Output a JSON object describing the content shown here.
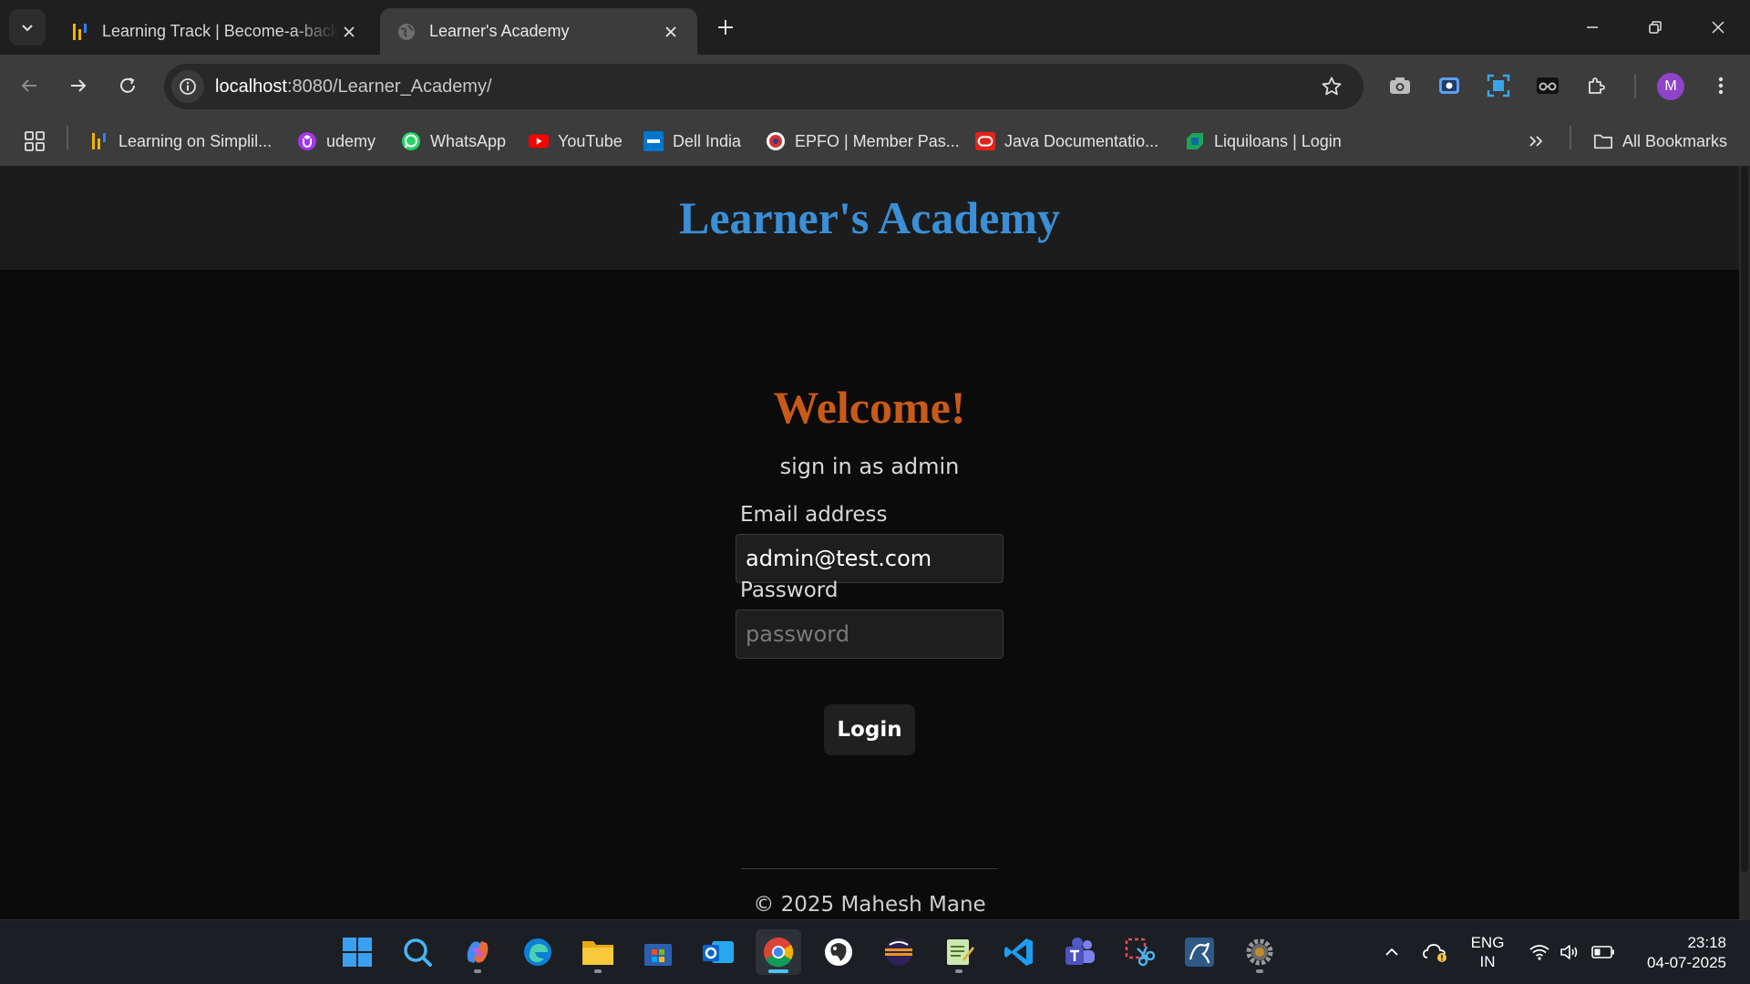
{
  "browser": {
    "tabs": [
      {
        "title": "Learning Track | Become-a-backend",
        "active": false
      },
      {
        "title": "Learner's Academy",
        "active": true
      }
    ],
    "url_host": "localhost",
    "url_path": ":8080/Learner_Academy/",
    "profile_initial": "M",
    "bookmarks": [
      {
        "label": "Learning on Simplil...",
        "icon": "simplilearn-icon"
      },
      {
        "label": "udemy",
        "icon": "udemy-icon"
      },
      {
        "label": "WhatsApp",
        "icon": "whatsapp-icon"
      },
      {
        "label": "YouTube",
        "icon": "youtube-icon"
      },
      {
        "label": "Dell India",
        "icon": "dell-icon"
      },
      {
        "label": "EPFO | Member Pas...",
        "icon": "epfo-icon"
      },
      {
        "label": "Java Documentatio...",
        "icon": "oracle-icon"
      },
      {
        "label": "Liquiloans | Login",
        "icon": "liquiloans-icon"
      }
    ],
    "all_bookmarks_label": "All Bookmarks"
  },
  "page": {
    "site_title": "Learner's Academy",
    "welcome": "Welcome!",
    "subtitle": "sign in as admin",
    "email_label": "Email address",
    "email_value": "admin@test.com",
    "password_label": "Password",
    "password_placeholder": "password",
    "login_label": "Login",
    "footer": "© 2025 Mahesh Mane"
  },
  "taskbar": {
    "apps": [
      "start-icon",
      "search-icon",
      "copilot-icon",
      "edge-icon",
      "file-explorer-icon",
      "microsoft-store-icon",
      "outlook-icon",
      "chrome-icon",
      "pgadmin-icon",
      "eclipse-icon",
      "notepad-icon",
      "vscode-icon",
      "teams-icon",
      "snipping-tool-icon",
      "mysql-workbench-icon",
      "settings-icon"
    ],
    "language": "ENG",
    "region": "IN",
    "time": "23:18",
    "date": "04-07-2025"
  },
  "colors": {
    "site_title": "#3a8fd6",
    "welcome": "#c85a18",
    "page_bg": "#0b0b0b",
    "header_bg": "#1c1c1c"
  }
}
